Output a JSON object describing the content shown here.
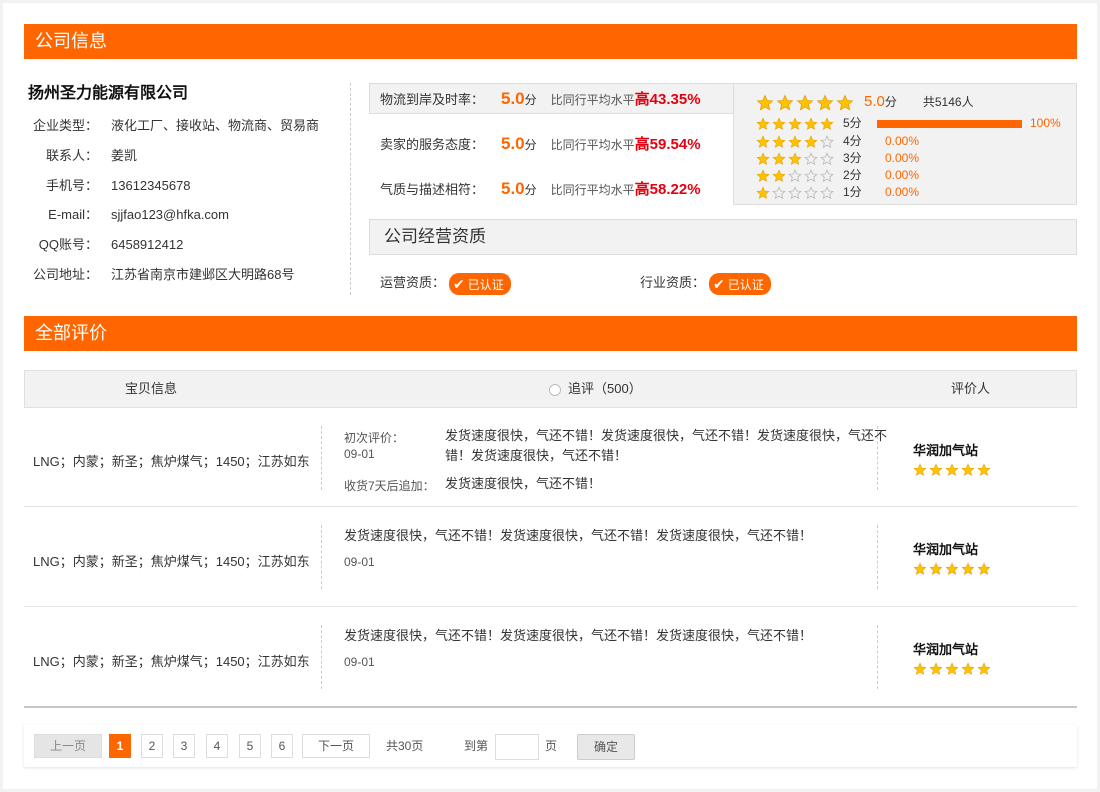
{
  "company_section": {
    "title": "公司信息",
    "name": "扬州圣力能源有限公司",
    "rows": [
      {
        "key": "企业类型：",
        "value": "液化工厂、接收站、物流商、贸易商"
      },
      {
        "key": "联系人：",
        "value": "姜凯"
      },
      {
        "key": "手机号：",
        "value": "13612345678"
      },
      {
        "key": "E-mail：",
        "value": "sjjfao123@hfka.com"
      },
      {
        "key": "QQ账号：",
        "value": "6458912412"
      },
      {
        "key": "公司地址：",
        "value": "江苏省南京市建邺区大明路68号"
      }
    ]
  },
  "scores": {
    "compare_prefix": "比同行平均水平",
    "unit": "分",
    "items": [
      {
        "label": "物流到岸及时率：",
        "score": "5.0",
        "pct": "高43.35%"
      },
      {
        "label": "卖家的服务态度：",
        "score": "5.0",
        "pct": "高59.54%"
      },
      {
        "label": "气质与描述相符：",
        "score": "5.0",
        "pct": "高58.22%"
      }
    ]
  },
  "rating_dist": {
    "avg": "5.0",
    "avg_unit": "分",
    "total": "共5146人",
    "avg_stars": 5,
    "lines": [
      {
        "stars": 5,
        "label": "5分",
        "pct": "100%",
        "fraction": 1.0
      },
      {
        "stars": 4,
        "label": "4分",
        "pct": "0.00%",
        "fraction": 0
      },
      {
        "stars": 3,
        "label": "3分",
        "pct": "0.00%",
        "fraction": 0
      },
      {
        "stars": 2,
        "label": "2分",
        "pct": "0.00%",
        "fraction": 0
      },
      {
        "stars": 1,
        "label": "1分",
        "pct": "0.00%",
        "fraction": 0
      }
    ]
  },
  "qualification": {
    "title": "公司经营资质",
    "items": [
      {
        "label": "运营资质：",
        "badge": "已认证"
      },
      {
        "label": "行业资质：",
        "badge": "已认证"
      }
    ]
  },
  "reviews_section": {
    "title": "全部评价",
    "headers": {
      "product": "宝贝信息",
      "followup": "追评（500）",
      "reviewer": "评价人"
    },
    "rows": [
      {
        "product": "LNG；内蒙；新圣；焦炉煤气；1450；江苏如东",
        "first_label": "初次评价：",
        "date": "09-01",
        "text_line1": "发货速度很快，气还不错！发货速度很快，气还不错！发货速度很快，气还不",
        "text_line2": "错！发货速度很快，气还不错！",
        "add_label": "收货7天后追加：",
        "add_text": "发货速度很快，气还不错！",
        "reviewer": "华润加气站",
        "stars": 5
      },
      {
        "product": "LNG；内蒙；新圣；焦炉煤气；1450；江苏如东",
        "text": "发货速度很快，气还不错！发货速度很快，气还不错！发货速度很快，气还不错！",
        "date": "09-01",
        "reviewer": "华润加气站",
        "stars": 5
      },
      {
        "product": "LNG；内蒙；新圣；焦炉煤气；1450；江苏如东",
        "text": "发货速度很快，气还不错！发货速度很快，气还不错！发货速度很快，气还不错！",
        "date": "09-01",
        "reviewer": "华润加气站",
        "stars": 5
      }
    ]
  },
  "pagination": {
    "prev": "上一页",
    "pages": [
      "1",
      "2",
      "3",
      "4",
      "5",
      "6"
    ],
    "current": "1",
    "next": "下一页",
    "total": "共30页",
    "goto_label": "到第",
    "page_unit": "页",
    "input_value": "",
    "confirm": "确定"
  },
  "colors": {
    "accent": "#ff6600",
    "highlight": "#e4000f",
    "star": "#ffc400",
    "star_empty": "#bbbbbb"
  }
}
